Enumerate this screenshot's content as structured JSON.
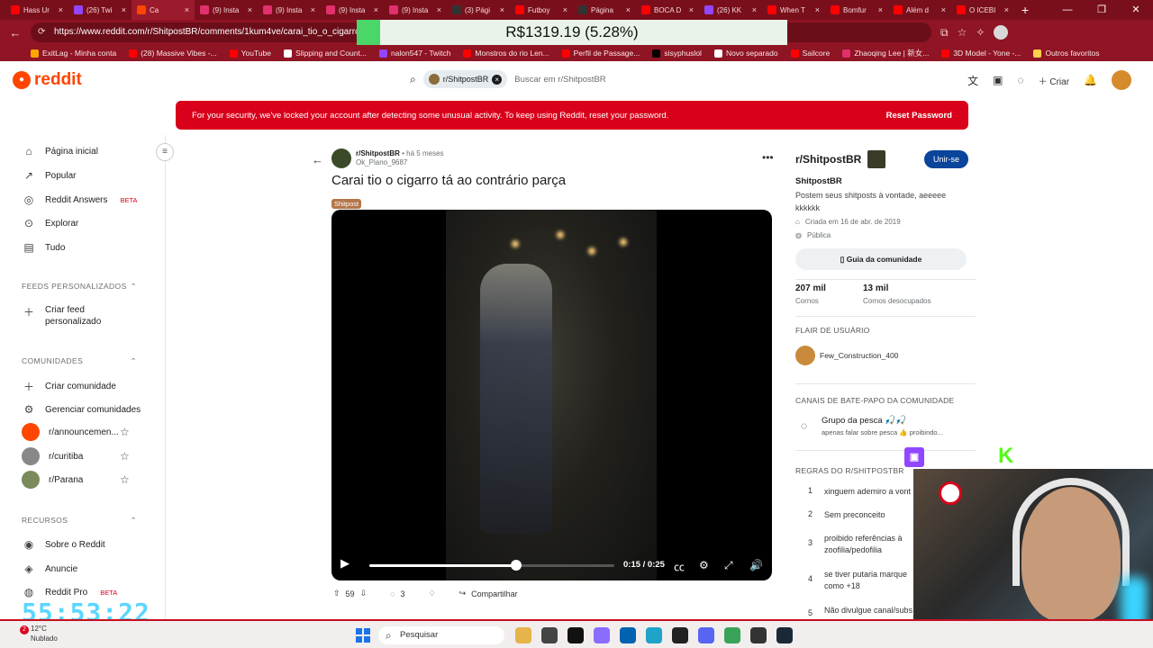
{
  "browser": {
    "tabs": [
      {
        "label": "Hass Ur",
        "color": "#ff0000"
      },
      {
        "label": "(26) Twi",
        "color": "#9146ff"
      },
      {
        "label": "Ca",
        "color": "#ff4500"
      },
      {
        "label": "(9) Insta",
        "color": "#e1306c"
      },
      {
        "label": "(9) Insta",
        "color": "#e1306c"
      },
      {
        "label": "(9) Insta",
        "color": "#e1306c"
      },
      {
        "label": "(9) Insta",
        "color": "#e1306c"
      },
      {
        "label": "(3) Pági",
        "color": "#333333"
      },
      {
        "label": "Futboy",
        "color": "#ff0000"
      },
      {
        "label": "Página",
        "color": "#333333"
      },
      {
        "label": "BOCA D",
        "color": "#ff0000"
      },
      {
        "label": "(26) KK",
        "color": "#9146ff"
      },
      {
        "label": "When T",
        "color": "#ff0000"
      },
      {
        "label": "Bomfur",
        "color": "#ff0000"
      },
      {
        "label": "Além d",
        "color": "#ff0000"
      },
      {
        "label": "O ICEBI",
        "color": "#ff0000"
      }
    ],
    "url": "https://www.reddit.com/r/ShitpostBR/comments/1kum4ve/carai_tio_o_cigarro",
    "bookmarks": [
      {
        "label": "ExitLag - Minha conta",
        "color": "#ffa500"
      },
      {
        "label": "(28) Massive Vibes -...",
        "color": "#ff0000"
      },
      {
        "label": "YouTube",
        "color": "#ff0000"
      },
      {
        "label": "Slipping and Count...",
        "color": "#ffffff"
      },
      {
        "label": "nalon547 - Twitch",
        "color": "#9146ff"
      },
      {
        "label": "Monstros do rio Len...",
        "color": "#ff0000"
      },
      {
        "label": "Perfil de Passage...",
        "color": "#ff0000"
      },
      {
        "label": "sisyphuslol",
        "color": "#000000"
      },
      {
        "label": "Novo separado",
        "color": "#ffffff"
      },
      {
        "label": "Sailcore",
        "color": "#ff0000"
      },
      {
        "label": "Zhaoqing Lee | 新女...",
        "color": "#e1306c"
      },
      {
        "label": "3D Model - Yone -...",
        "color": "#ff0000"
      },
      {
        "label": "Outros favoritos",
        "color": "#ffd24d"
      }
    ],
    "price_overlay": "R$1319.19 (5.28%)"
  },
  "header": {
    "logo": "reddit",
    "search_chip": "r/ShitpostBR",
    "search_placeholder": "Buscar em r/ShitpostBR",
    "create_label": "Criar"
  },
  "banner": {
    "text": "For your security, we've locked your account after detecting some unusual activity. To keep using Reddit, reset your password.",
    "action": "Reset Password"
  },
  "sidebar": {
    "main": [
      {
        "label": "Página inicial",
        "icon": "home-icon"
      },
      {
        "label": "Popular",
        "icon": "popular-icon"
      },
      {
        "label": "Reddit Answers",
        "icon": "answers-icon",
        "badge": "BETA"
      },
      {
        "label": "Explorar",
        "icon": "explore-icon"
      },
      {
        "label": "Tudo",
        "icon": "all-icon"
      }
    ],
    "feeds_header": "FEEDS PERSONALIZADOS",
    "feeds_create_line1": "Criar feed",
    "feeds_create_line2": "personalizado",
    "communities_header": "COMUNIDADES",
    "communities_actions": [
      "Criar comunidade",
      "Gerenciar comunidades"
    ],
    "communities": [
      {
        "label": "r/announcemen...",
        "color": "#ff4500"
      },
      {
        "label": "r/curitiba",
        "color": "#888888"
      },
      {
        "label": "r/Parana",
        "color": "#7a8a5a"
      }
    ],
    "resources_header": "RECURSOS",
    "resources": [
      {
        "label": "Sobre o Reddit"
      },
      {
        "label": "Anuncie"
      },
      {
        "label": "Reddit Pro",
        "badge": "BETA"
      }
    ]
  },
  "post": {
    "subreddit": "r/ShitpostBR",
    "time": "há 5 meses",
    "author": "Ok_Piano_9687",
    "title": "Carai tio o cigarro tá ao contrário parça",
    "flair": "Shitpost",
    "video": {
      "time": "0:15 / 0:25",
      "progress": 0.6
    },
    "upvotes": "59",
    "comments": "3",
    "share": "Compartilhar"
  },
  "community": {
    "title": "r/ShitpostBR",
    "join": "Unir-se",
    "name": "ShitpostBR",
    "description": "Postem seus shitposts à vontade, aeeeee kkkkkk",
    "created": "Criada em 16 de abr. de 2019",
    "visibility": "Pública",
    "guide": "Guia da comunidade",
    "members": "207 mil",
    "members_label": "Cornos",
    "online": "13 mil",
    "online_label": "Cornos desocupados",
    "user_flair_header": "FLAIR DE USUÁRIO",
    "user_flair": "Few_Construction_400",
    "chat_header": "CANAIS DE BATE-PAPO DA COMUNIDADE",
    "chat_name": "Grupo da pesca 🎣🎣",
    "chat_desc": "apenas falar sobre pesca 👍 proibindo...",
    "rules_header": "REGRAS DO R/SHITPOSTBR",
    "rules": [
      {
        "n": "1",
        "text": "xinguem ademiro a vont"
      },
      {
        "n": "2",
        "text": "Sem preconceito"
      },
      {
        "n": "3",
        "text": "proibido referências à zoofilia/pedofilia"
      },
      {
        "n": "4",
        "text": "se tiver putaria marque como +18"
      },
      {
        "n": "5",
        "text": "Não divulgue canal/subs"
      }
    ]
  },
  "overlays": {
    "timer": "55:53:22"
  },
  "taskbar": {
    "temp": "12°C",
    "weather": "Nublado",
    "badge": "2",
    "search": "Pesquisar"
  }
}
